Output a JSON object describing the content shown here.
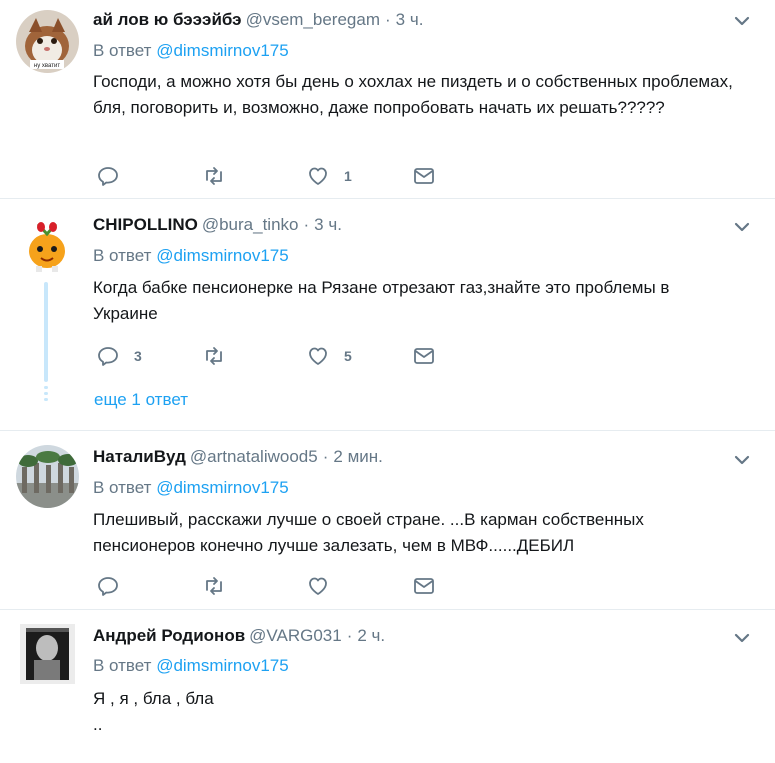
{
  "tweets": [
    {
      "name": "ай лов ю бэээйбэ",
      "handle": "@vsem_beregam",
      "dot": "·",
      "time": "3 ч.",
      "reply_prefix": "В ответ",
      "reply_mention": "@dimsmirnov175",
      "text": "Господи, а можно хотя бы день о хохлах не пиздеть и о собственных проблемах,\nбля, поговорить и, возможно, даже попробовать начать их решать?????",
      "avatar_caption": "ну хватит",
      "counts": {
        "reply": "",
        "retweet": "",
        "like": "1"
      }
    },
    {
      "name": "CHIPOLLINO",
      "handle": "@bura_tinko",
      "dot": "·",
      "time": "3 ч.",
      "reply_prefix": "В ответ",
      "reply_mention": "@dimsmirnov175",
      "text": "Когда бабке пенсионерке на Рязане отрезают газ,знайте это проблемы в Украине",
      "counts": {
        "reply": "3",
        "retweet": "",
        "like": "5"
      },
      "more_replies": "еще 1 ответ"
    },
    {
      "name": "НаталиВуд",
      "handle": "@artnataliwood5",
      "dot": "·",
      "time": "2 мин.",
      "reply_prefix": "В ответ",
      "reply_mention": "@dimsmirnov175",
      "text": "Плешивый, расскажи лучше о своей стране. ...В карман собственных пенсионеров конечно лучше залезать, чем в МВФ......ДЕБИЛ",
      "counts": {
        "reply": "",
        "retweet": "",
        "like": ""
      }
    },
    {
      "name": "Андрей Родионов",
      "handle": "@VARG031",
      "dot": "·",
      "time": "2 ч.",
      "reply_prefix": "В ответ",
      "reply_mention": "@dimsmirnov175",
      "text": "Я , я , бла , бла\n..",
      "counts": {
        "reply": "",
        "retweet": "",
        "like": ""
      }
    }
  ],
  "colors": {
    "link": "#1da1f2",
    "secondary_text": "#657786",
    "primary_text": "#14171a",
    "divider": "#e6ecf0",
    "thread_line": "#c8e7fb"
  },
  "icons": [
    "reply-icon",
    "retweet-icon",
    "like-icon",
    "direct-message-icon",
    "caret-down-icon"
  ]
}
